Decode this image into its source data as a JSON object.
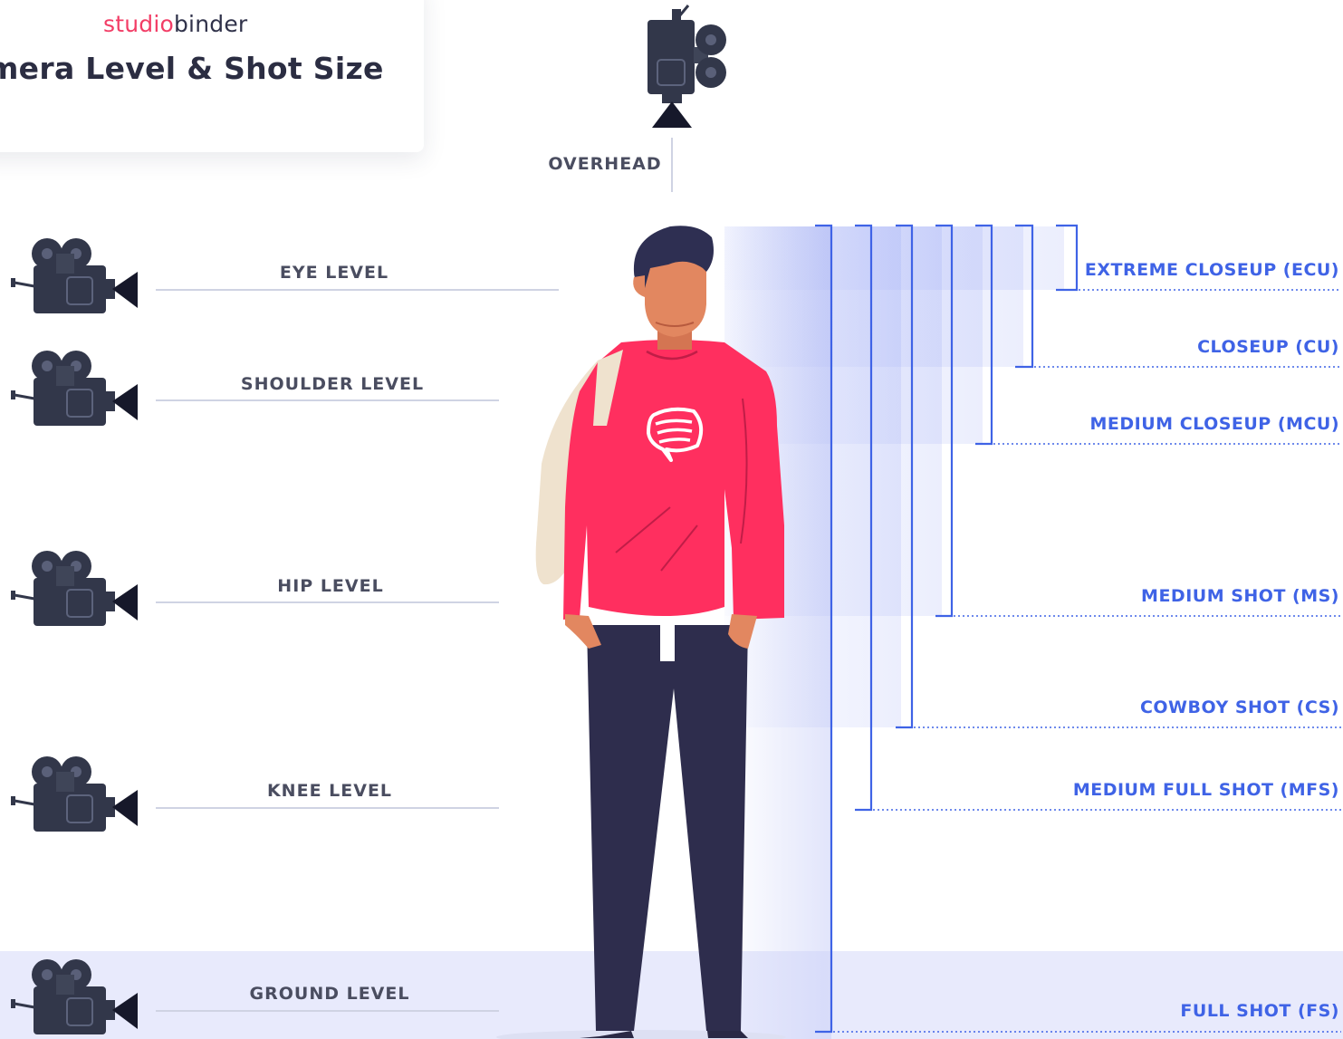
{
  "brand": {
    "prefix": "studio",
    "suffix": "binder"
  },
  "title": "mera Level & Shot Size",
  "camera_levels": [
    {
      "label": "OVERHEAD"
    },
    {
      "label": "EYE LEVEL"
    },
    {
      "label": "SHOULDER LEVEL"
    },
    {
      "label": "HIP LEVEL"
    },
    {
      "label": "KNEE LEVEL"
    },
    {
      "label": "GROUND LEVEL"
    }
  ],
  "shot_sizes": [
    {
      "label": "EXTREME CLOSEUP (ECU)"
    },
    {
      "label": "CLOSEUP (CU)"
    },
    {
      "label": "MEDIUM CLOSEUP (MCU)"
    },
    {
      "label": "MEDIUM SHOT (MS)"
    },
    {
      "label": "COWBOY SHOT (CS)"
    },
    {
      "label": "MEDIUM FULL SHOT (MFS)"
    },
    {
      "label": "FULL SHOT (FS)"
    }
  ],
  "icons": {
    "camera": "movie-camera-icon",
    "logo": "speech-bubble-icon",
    "person": "person-figure"
  },
  "colors": {
    "accent_blue": "#3f63e6",
    "brand_pink": "#f23d66",
    "shirt": "#ff2f5f",
    "pants": "#2e2d4d",
    "skin": "#e28760",
    "hair": "#2e2f52",
    "bag": "#efe2ce",
    "camera": "#32374a",
    "ground_band": "#e8eafc",
    "text_dark": "#4a4d60"
  }
}
